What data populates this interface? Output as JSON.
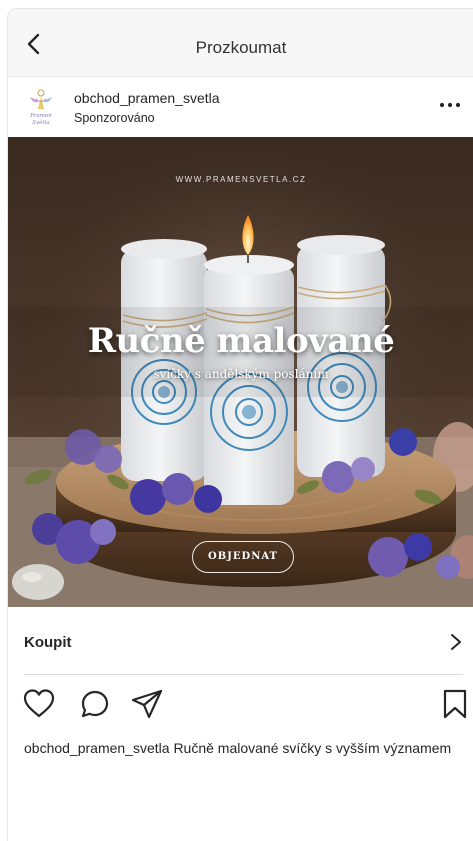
{
  "nav": {
    "title": "Prozkoumat",
    "back_icon": "chevron-left-icon"
  },
  "post": {
    "account": "obchod_pramen_svetla",
    "sponsored_label": "Sponzorováno",
    "avatar_text_1": "Pramen",
    "avatar_text_2": "Světla",
    "more_icon": "more-horizontal-icon"
  },
  "image": {
    "url_text": "WWW.PRAMENSVETLA.CZ",
    "headline": "Ručně malované",
    "subheadline": "svíčky s andělským posláním",
    "cta": "OBJEDNAT"
  },
  "buy": {
    "label": "Koupit",
    "chevron_icon": "chevron-right-icon"
  },
  "actions": {
    "like_icon": "heart-icon",
    "comment_icon": "comment-icon",
    "share_icon": "send-icon",
    "save_icon": "bookmark-icon"
  },
  "caption": {
    "user": "obchod_pramen_svetla",
    "text": "Ručně malované svíčky s vyšším významem"
  },
  "colors": {
    "text": "#262626",
    "nav_bg": "#f7f7f7",
    "divider": "#dbdbdb",
    "lace_blue": "#2e7fb5"
  }
}
